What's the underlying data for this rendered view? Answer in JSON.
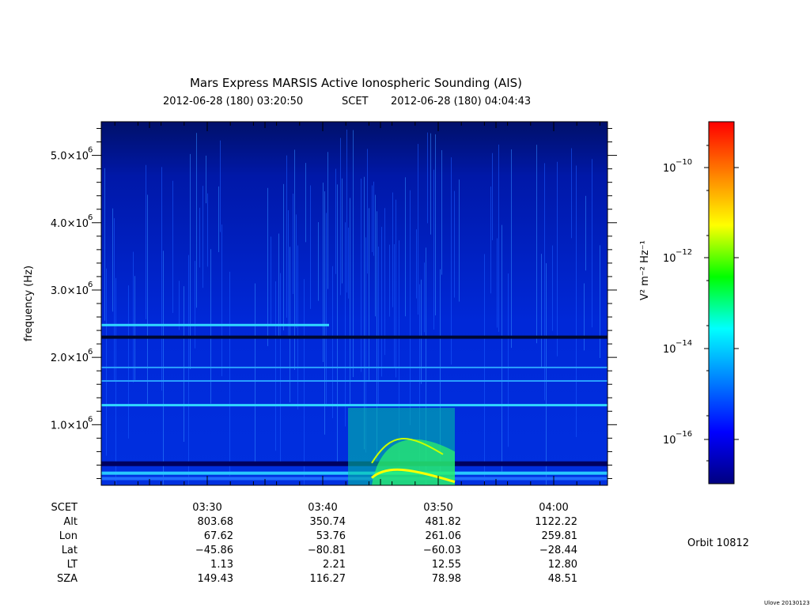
{
  "chart_data": {
    "type": "heatmap",
    "title": "Mars Express MARSIS Active Ionospheric Sounding (AIS)",
    "time_start": "2012-06-28 (180) 03:20:50",
    "time_label": "SCET",
    "time_end": "2012-06-28 (180) 04:04:43",
    "ylabel": "frequency (Hz)",
    "y_ticks": [
      {
        "value": 1000000,
        "label_base": "1.0×10",
        "label_exp": "6"
      },
      {
        "value": 2000000,
        "label_base": "2.0×10",
        "label_exp": "6"
      },
      {
        "value": 3000000,
        "label_base": "3.0×10",
        "label_exp": "6"
      },
      {
        "value": 4000000,
        "label_base": "4.0×10",
        "label_exp": "6"
      },
      {
        "value": 5000000,
        "label_base": "5.0×10",
        "label_exp": "6"
      }
    ],
    "ylim": [
      100000,
      5500000
    ],
    "x_ticks": [
      "03:30",
      "03:40",
      "03:50",
      "04:00"
    ],
    "colorbar": {
      "label": "V² m⁻² Hz⁻¹",
      "scale": "log",
      "ticks": [
        {
          "base": "10",
          "exp": "−10"
        },
        {
          "base": "10",
          "exp": "−12"
        },
        {
          "base": "10",
          "exp": "−14"
        },
        {
          "base": "10",
          "exp": "−16"
        }
      ],
      "colors": [
        "#000080",
        "#0000ff",
        "#0080ff",
        "#00ffff",
        "#00ff00",
        "#ffff00",
        "#ff8000",
        "#ff0000"
      ]
    },
    "ephemeris": {
      "labels": [
        "SCET",
        "Alt",
        "Lon",
        "Lat",
        "LT",
        "SZA"
      ],
      "columns": [
        {
          "time": "03:30",
          "Alt": "803.68",
          "Lon": "67.62",
          "Lat": "−45.86",
          "LT": "1.13",
          "SZA": "149.43"
        },
        {
          "time": "03:40",
          "Alt": "350.74",
          "Lon": "53.76",
          "Lat": "−80.81",
          "LT": "2.21",
          "SZA": "116.27"
        },
        {
          "time": "03:50",
          "Alt": "481.82",
          "Lon": "261.06",
          "Lat": "−60.03",
          "LT": "12.55",
          "SZA": "78.98"
        },
        {
          "time": "04:00",
          "Alt": "1122.22",
          "Lon": "259.81",
          "Lat": "−28.44",
          "LT": "12.80",
          "SZA": "48.51"
        }
      ]
    },
    "orbit": "Orbit 10812",
    "credit": "Ulove 20130123"
  }
}
